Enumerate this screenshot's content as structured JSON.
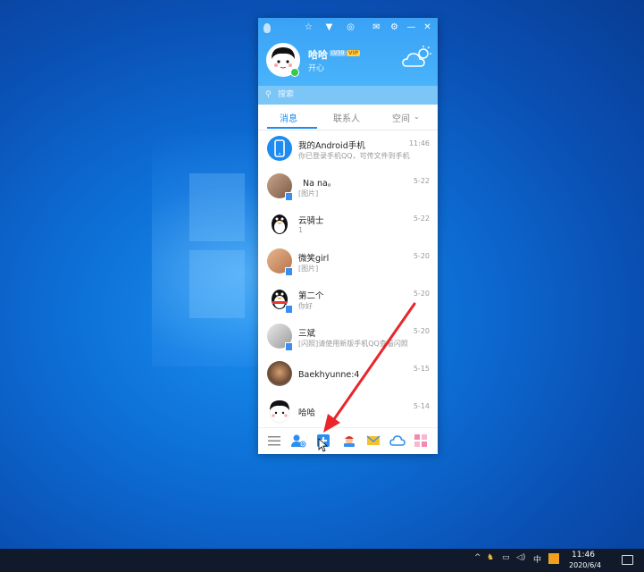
{
  "qq": {
    "profile": {
      "nickname": "哈哈",
      "level": "LV39",
      "vip": "VIP",
      "signature": "开心"
    },
    "search": {
      "placeholder": "搜索"
    },
    "tabs": [
      {
        "label": "消息",
        "active": true
      },
      {
        "label": "联系人",
        "active": false
      },
      {
        "label": "空间",
        "active": false
      }
    ],
    "conversations": [
      {
        "name": "我的Android手机",
        "preview": "你已登录手机QQ，可传文件到手机",
        "time": "11:46",
        "avatar": "phone-icon"
      },
      {
        "name": "Na na。",
        "preview": "[图片]",
        "time": "5-22",
        "avatar": "photo-avatar"
      },
      {
        "name": "云骑士",
        "preview": "1",
        "time": "5-22",
        "avatar": "penguin-avatar"
      },
      {
        "name": "微笑girl",
        "preview": "[图片]",
        "time": "5-20",
        "avatar": "photo-avatar"
      },
      {
        "name": "第二个",
        "preview": "你好",
        "time": "5-20",
        "avatar": "penguin-avatar"
      },
      {
        "name": "三斌",
        "preview": "[闪照]请使用新版手机QQ查看闪照",
        "time": "5-20",
        "avatar": "photo-avatar"
      },
      {
        "name": "Baekhyunne:4",
        "preview": "",
        "time": "5-15",
        "avatar": "photo-avatar"
      },
      {
        "name": "哈哈",
        "preview": "",
        "time": "5-14",
        "avatar": "cartoon-avatar"
      }
    ],
    "bottom_icons": [
      "menu-icon",
      "add-friend-icon",
      "app-manager-icon",
      "game-icon",
      "mail-icon",
      "weiyun-icon",
      "apps-icon"
    ]
  },
  "taskbar": {
    "ime": "中",
    "time": "11:46",
    "date": "2020/6/4"
  },
  "colors": {
    "header_blue": "#3aa2f5",
    "accent": "#1d8bf0",
    "arrow_red": "#e8262b",
    "taskbar": "#101a2b"
  }
}
